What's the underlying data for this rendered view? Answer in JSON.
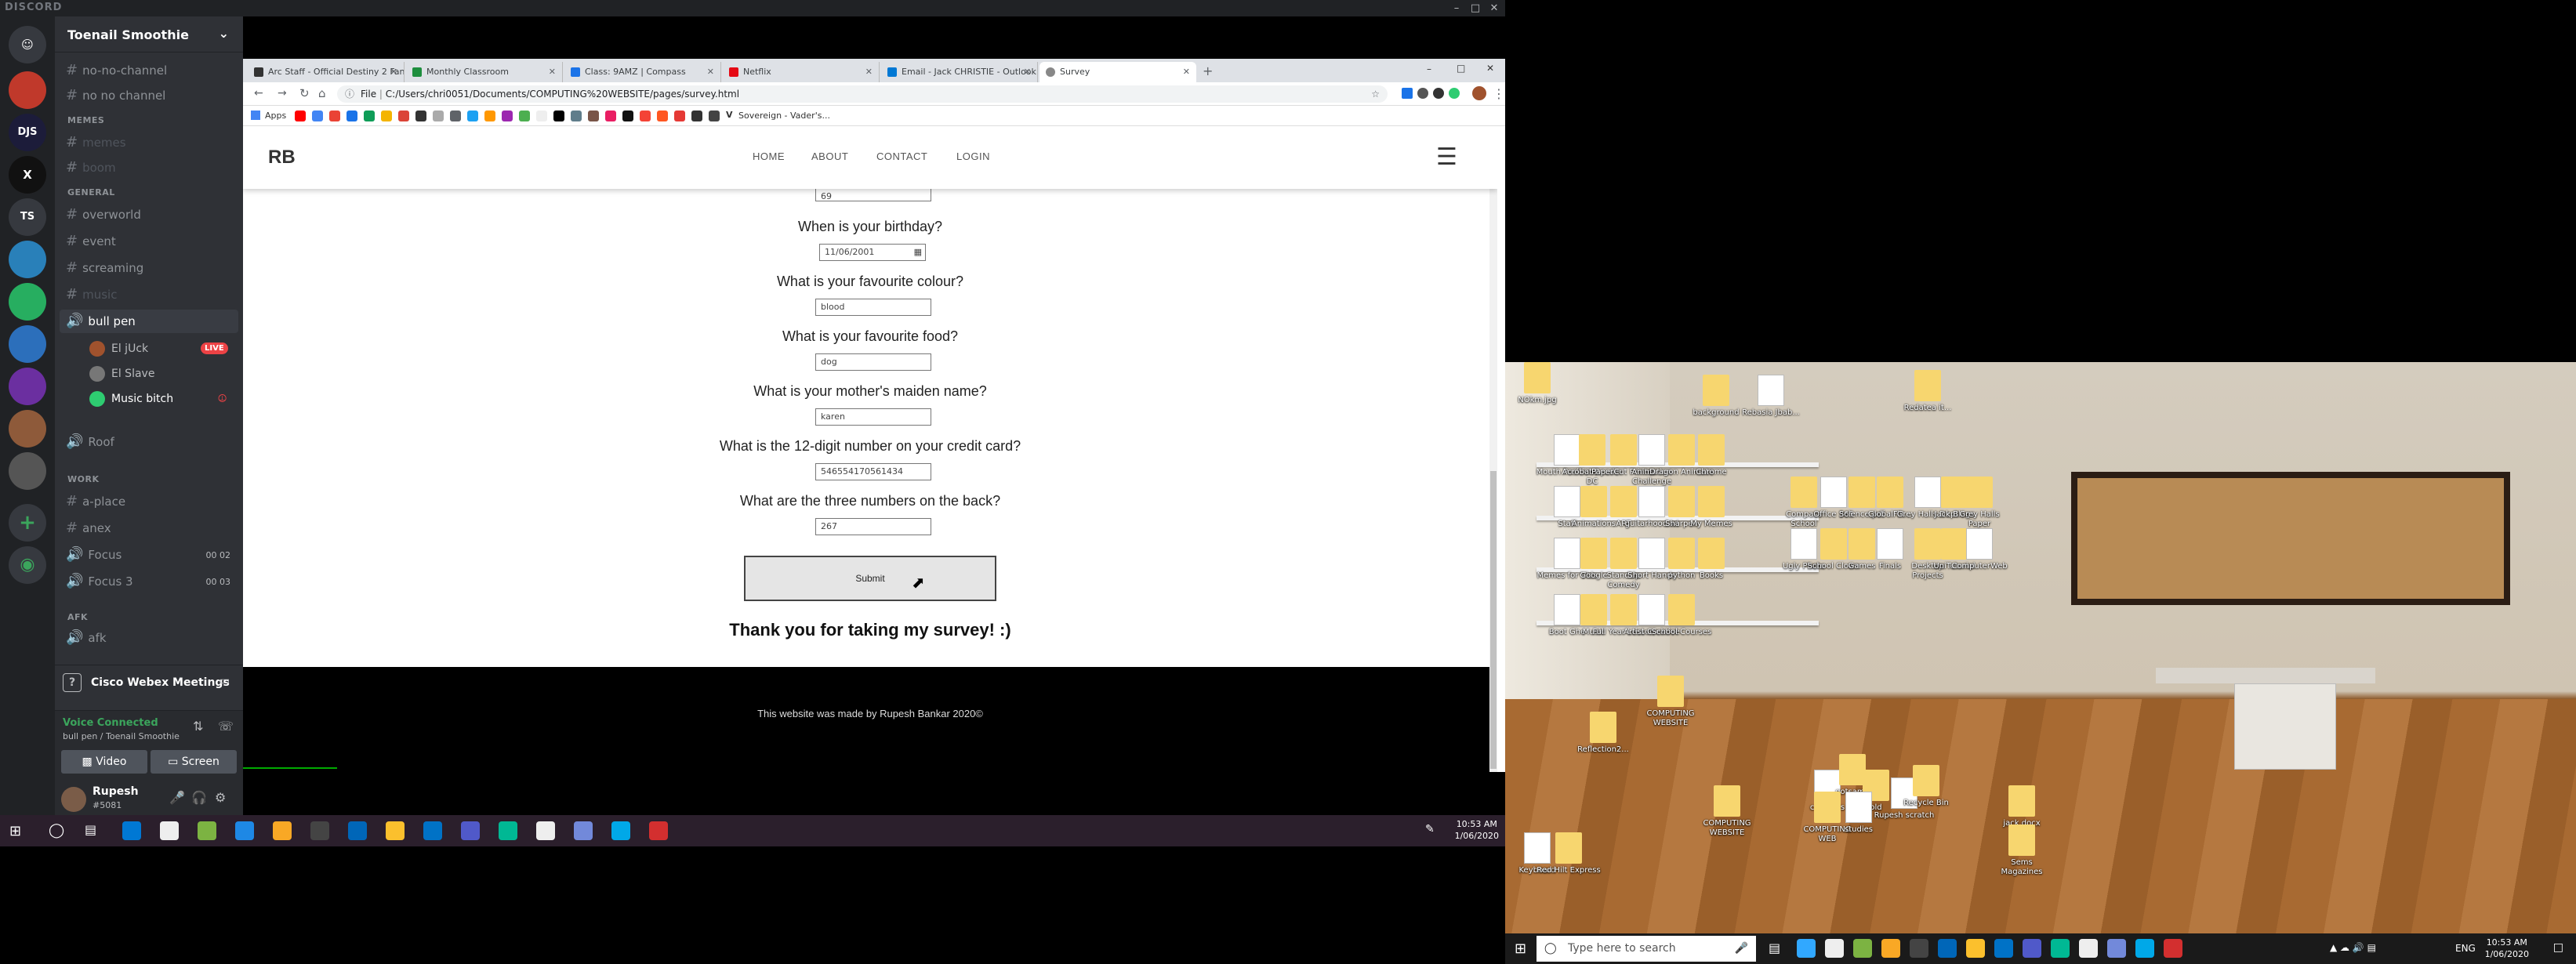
{
  "discord": {
    "app_name": "DISCORD",
    "server_name": "Toenail Smoothie",
    "channels_top": [
      "no-no-channel",
      "no no channel"
    ],
    "categories": {
      "memes": "MEMES",
      "general": "GENERAL",
      "work": "WORK",
      "afk": "AFK"
    },
    "memes_channels": [
      "memes",
      "boom"
    ],
    "general_channels": [
      "overworld",
      "event",
      "screaming",
      "music"
    ],
    "voice_channel": "bull pen",
    "voice_users": [
      {
        "name": "El jUck",
        "badge": "LIVE"
      },
      {
        "name": "El Slave"
      },
      {
        "name": "Music bitch"
      }
    ],
    "roof_channel": "Roof",
    "work_channels": [
      "a-place",
      "anex"
    ],
    "focus_channels": [
      {
        "name": "Focus",
        "count": "00 02"
      },
      {
        "name": "Focus 3",
        "count": "00 03"
      }
    ],
    "afk_channel": "afk",
    "webex_label": "Cisco Webex Meetings",
    "voice_status": "Voice Connected",
    "voice_location": "bull pen / Toenail Smoothie",
    "video_label": "Video",
    "screen_label": "Screen",
    "username": "Rupesh",
    "discriminator": "#5081",
    "guild_label_ts": "TS"
  },
  "chrome": {
    "tabs": [
      {
        "title": "Arc Staff - Official Destiny 2 Fan...",
        "color": "#333333"
      },
      {
        "title": "Monthly Classroom",
        "color": "#1e8e3e"
      },
      {
        "title": "Class: 9AMZ | Compass",
        "color": "#1a73e8"
      },
      {
        "title": "Netflix",
        "color": "#e50914"
      },
      {
        "title": "Email - Jack CHRISTIE - Outlook",
        "color": "#0078d4"
      },
      {
        "title": "Survey",
        "color": "#888888"
      }
    ],
    "url_prefix": "File",
    "url": "C:/Users/chri0051/Documents/COMPUTING%20WEBSITE/pages/survey.html",
    "bookmarks_apps": "Apps",
    "bookmark_last": "Sovereign - Vader's..."
  },
  "site": {
    "logo": "RB",
    "nav": [
      "HOME",
      "ABOUT",
      "CONTACT",
      "LOGIN"
    ],
    "questions": [
      {
        "q": "",
        "a": "69"
      },
      {
        "q": "When is your birthday?",
        "a": "11/06/2001"
      },
      {
        "q": "What is your favourite colour?",
        "a": "blood"
      },
      {
        "q": "What is your favourite food?",
        "a": "dog"
      },
      {
        "q": "What is your mother's maiden name?",
        "a": "karen"
      },
      {
        "q": "What is the 12-digit number on your credit card?",
        "a": "546554170561434"
      },
      {
        "q": "What are the three numbers on the back?",
        "a": "267"
      }
    ],
    "submit_label": "Submit",
    "thanks": "Thank you for taking my survey! :)",
    "footer": "This website was made by Rupesh Bankar 2020©"
  },
  "taskbar_left": {
    "time": "10:53 AM",
    "date": "1/06/2020"
  },
  "desktop": {
    "icons": [
      "NOkm.jpg",
      "Mouth Positions",
      "Acrobat Reader DC",
      "PaperCut Printer",
      "Animation Challenge",
      "Dragon Animate",
      "Chrome",
      "Staff",
      "Animations",
      "ART",
      "guitarhood.wi",
      "Sharpen",
      "My Memes",
      "Memes for Vids",
      "Google",
      "StandUp Comedy",
      "Short Hands",
      "python",
      "Books",
      "Boot Ghe",
      "Music",
      "Full Year Lesson",
      "Artist Creative",
      "School Courses",
      "background",
      "Rebasia Jbab...",
      "Redatea it...",
      "Compass School",
      "Office 365",
      "Science.pdf",
      "GlobalFilt...",
      "Grey Halls Dept",
      "Jack Blogs",
      "Grey Halls Paper",
      "Ugly Photo",
      "School Clown",
      "Games",
      "Finals",
      "Desktop Projects",
      "UniTutorial",
      "ComputerWeb",
      "COMPUTING WEBSITE",
      "Reflection2...",
      "compass",
      "gotsame",
      "old",
      "Rupesh scratch",
      "COMPUTING WEBSITE",
      "COMPUTING WEB",
      "studies",
      "Recycle Bin",
      "jack.docx",
      "Keyboard",
      "Red Hilt Express",
      "Sems Magazines"
    ],
    "search_placeholder": "Type here to search",
    "lang": "ENG",
    "time": "10:53 AM",
    "date": "1/06/2020"
  }
}
